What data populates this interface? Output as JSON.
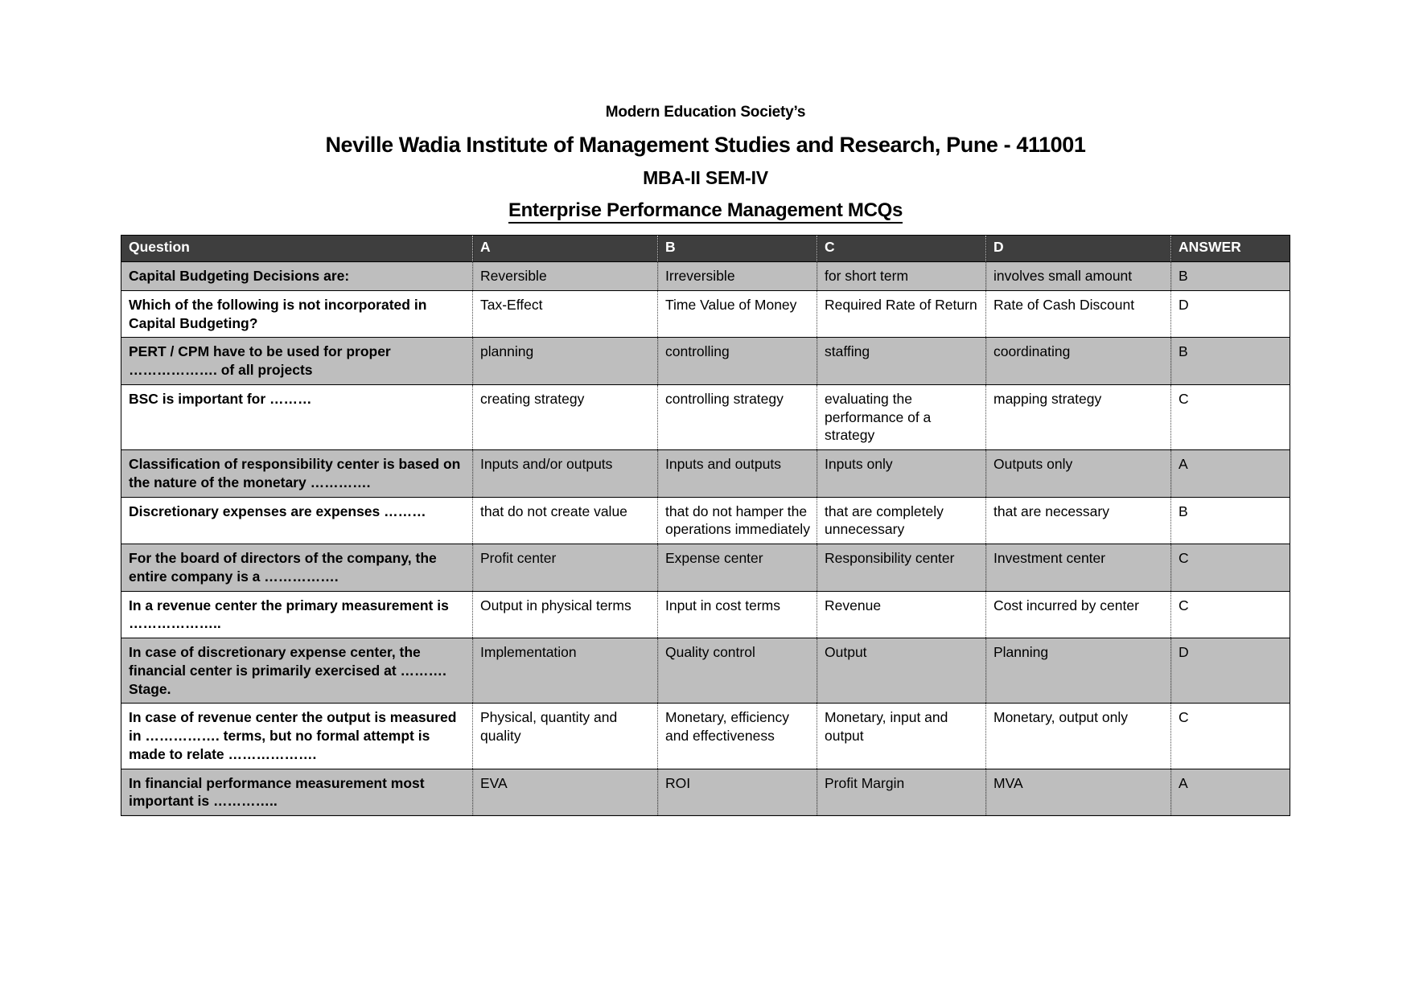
{
  "heading": {
    "org": "Modern Education Society’s",
    "institute": "Neville Wadia Institute of Management Studies and Research, Pune - 411001",
    "program": "MBA-II SEM-IV",
    "subject": "Enterprise Performance Management MCQs"
  },
  "table": {
    "columns": [
      "Question",
      "A",
      "B",
      "C",
      "D",
      "ANSWER"
    ],
    "rows": [
      {
        "question": "Capital Budgeting Decisions are:",
        "a": "Reversible",
        "b": "Irreversible",
        "c": "for short term",
        "d": "involves small amount",
        "answer": "B"
      },
      {
        "question": "Which of the following is not incorporated in Capital Budgeting?",
        "a": "Tax-Effect",
        "b": "Time Value of Money",
        "c": "Required Rate of Return",
        "d": "Rate of Cash Discount",
        "answer": "D"
      },
      {
        "question": "PERT / CPM have to be used for proper ………………. of all projects",
        "a": "planning",
        "b": "controlling",
        "c": "staffing",
        "d": "coordinating",
        "answer": "B"
      },
      {
        "question": "BSC is important for ………",
        "a": "creating strategy",
        "b": "controlling strategy",
        "c": "evaluating the performance of a strategy",
        "d": "mapping strategy",
        "answer": "C"
      },
      {
        "question": "Classification of responsibility center is based on the nature of the monetary ………….",
        "a": "Inputs and/or outputs",
        "b": "Inputs and outputs",
        "c": "Inputs only",
        "d": "Outputs only",
        "answer": "A"
      },
      {
        "question": "Discretionary expenses are expenses ………",
        "a": "that do not create value",
        "b": "that do not hamper the operations immediately",
        "c": "that are completely unnecessary",
        "d": "that are necessary",
        "answer": "B"
      },
      {
        "question": "For the board of directors of the company, the entire company is a …………….",
        "a": "Profit center",
        "b": "Expense center",
        "c": "Responsibility center",
        "d": "Investment center",
        "answer": "C"
      },
      {
        "question": "In a revenue center the primary measurement is ………………..",
        "a": "Output in physical terms",
        "b": "Input in cost terms",
        "c": "Revenue",
        "d": "Cost incurred by center",
        "answer": "C"
      },
      {
        "question": "In case of discretionary expense center, the financial center is primarily exercised at ………. Stage.",
        "a": "Implementation",
        "b": "Quality control",
        "c": "Output",
        "d": "Planning",
        "answer": "D"
      },
      {
        "question": "In case of revenue center the output is measured in ……………. terms, but no formal attempt is made to relate ……………….",
        "a": "Physical, quantity and quality",
        "b": "Monetary, efficiency and effectiveness",
        "c": "Monetary, input and output",
        "d": "Monetary, output only",
        "answer": "C"
      },
      {
        "question": "In financial performance measurement most important is …………..",
        "a": "EVA",
        "b": "ROI",
        "c": "Profit Margin",
        "d": "MVA",
        "answer": "A"
      }
    ]
  }
}
